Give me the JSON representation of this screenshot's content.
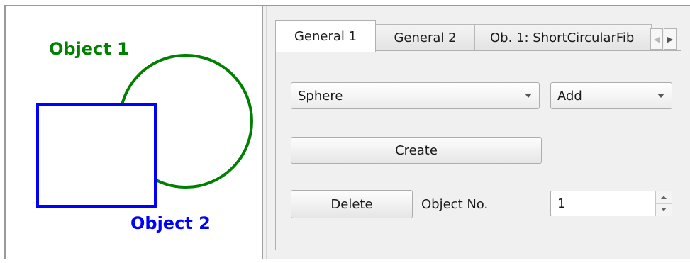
{
  "canvas": {
    "object1_label": "Object 1",
    "object2_label": "Object 2",
    "object1_color": "#008000",
    "object2_color": "#0000ff",
    "object1_shape": "circle",
    "object2_shape": "square"
  },
  "tabs": [
    {
      "label": "General 1",
      "active": true
    },
    {
      "label": "General 2",
      "active": false
    },
    {
      "label": "Ob. 1: ShortCircularFib",
      "active": false
    }
  ],
  "tab_scroll": {
    "left_icon": "chevron-left-icon",
    "right_icon": "chevron-right-icon"
  },
  "page": {
    "shape_select": {
      "value": "Sphere"
    },
    "mode_select": {
      "value": "Add"
    },
    "create_button": "Create",
    "delete_button": "Delete",
    "object_no_label": "Object No.",
    "object_no_value": "1"
  }
}
